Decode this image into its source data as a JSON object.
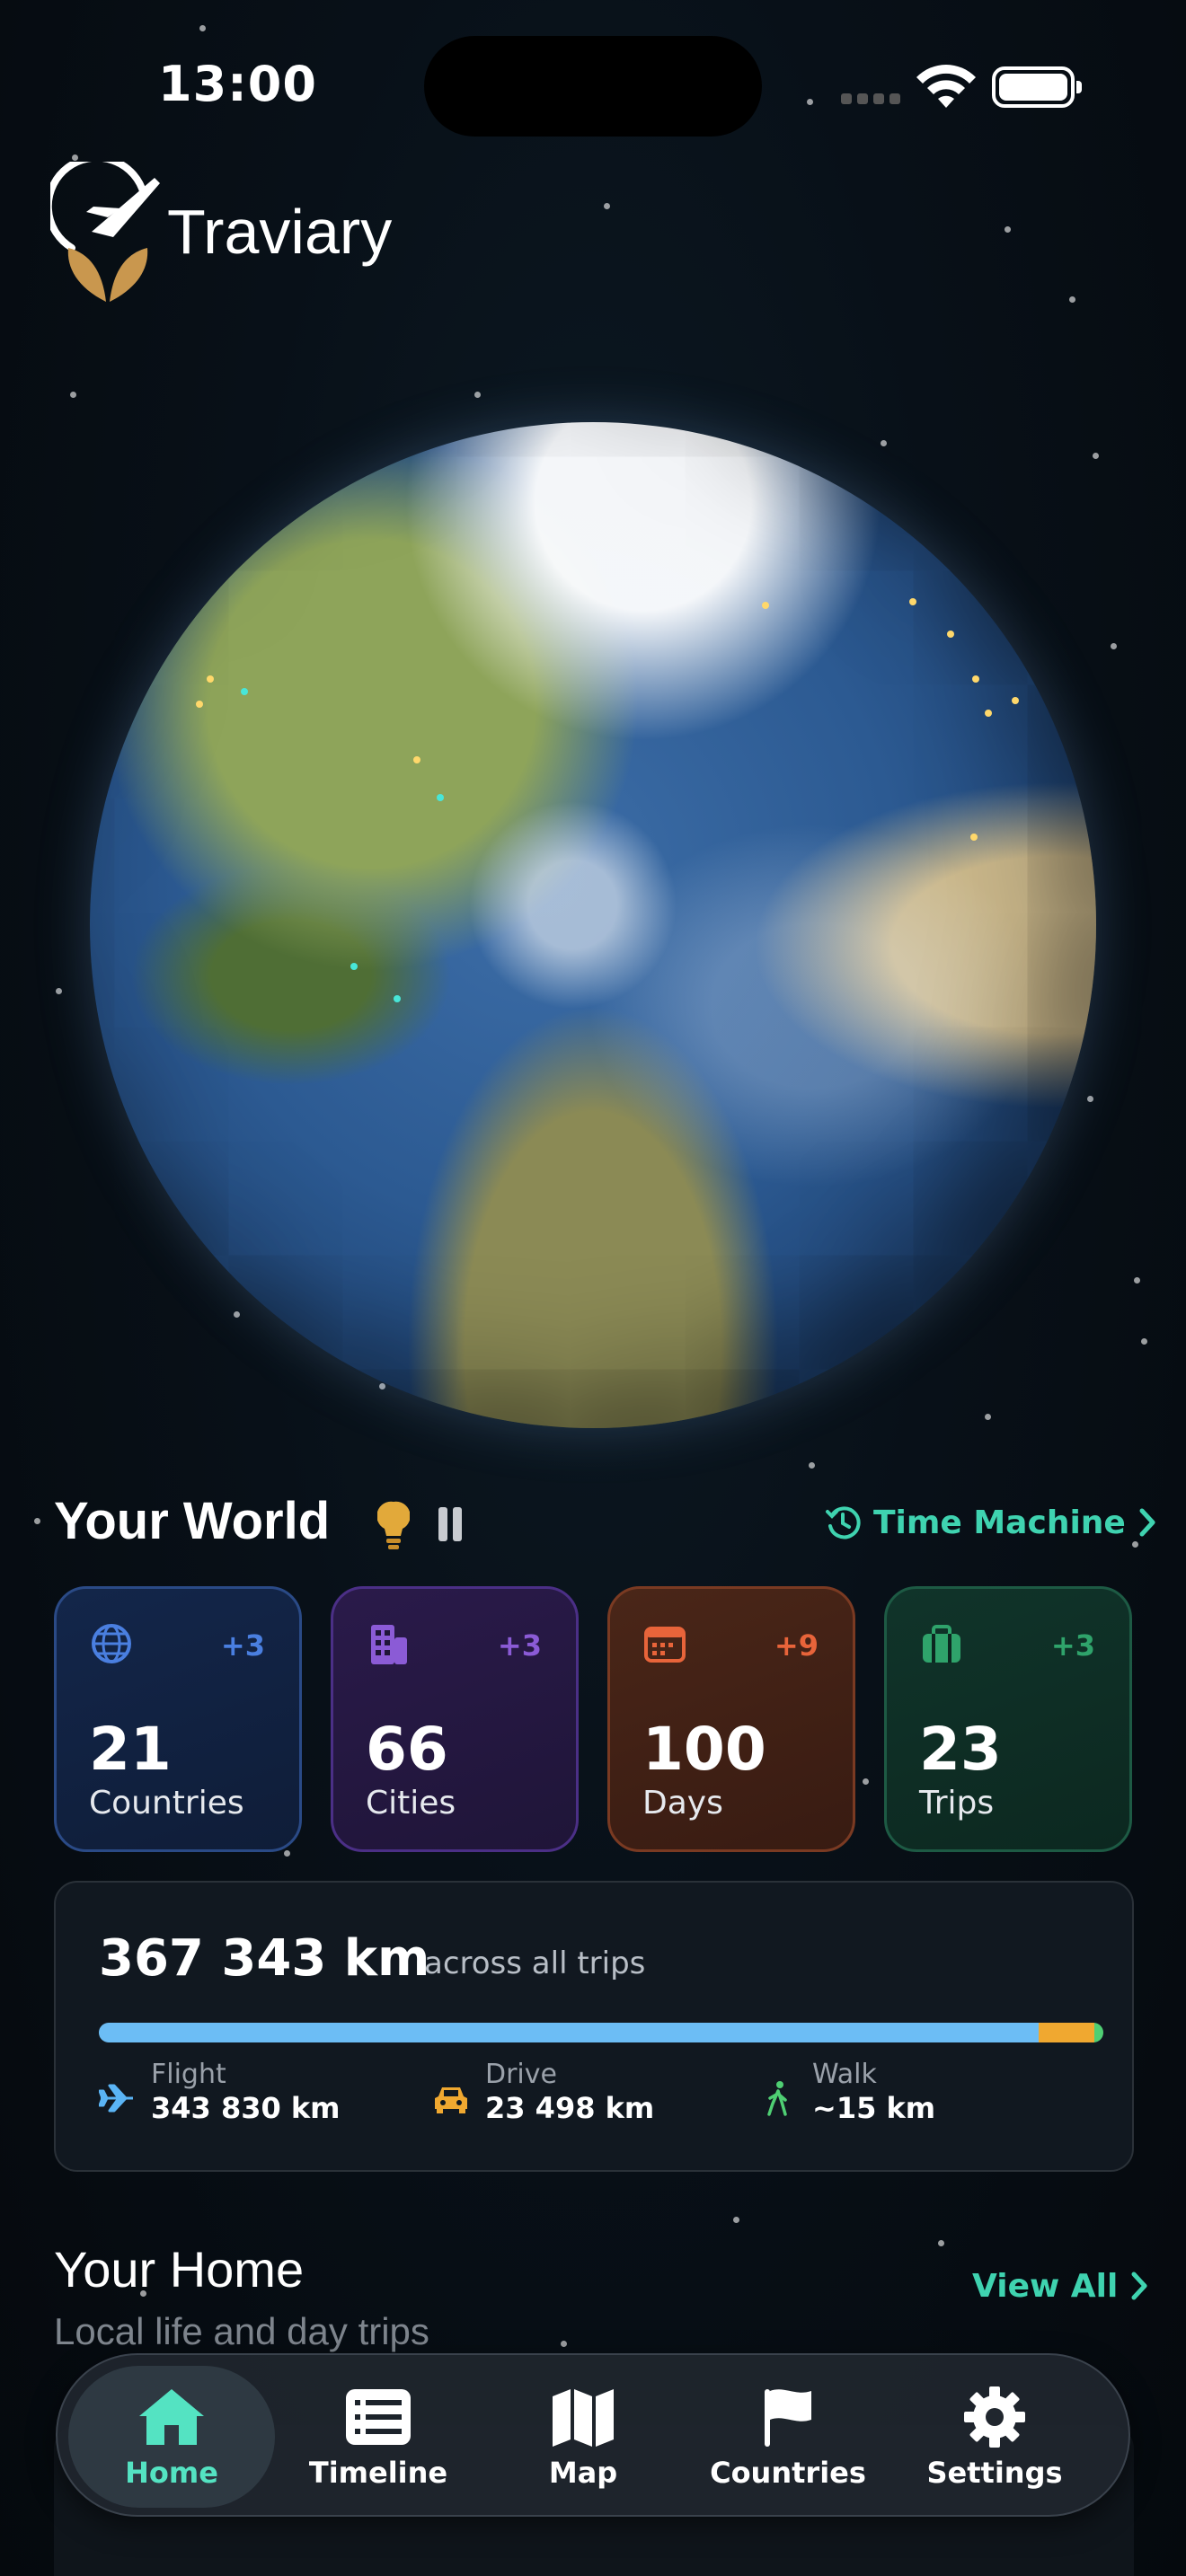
{
  "status_bar": {
    "time": "13:00"
  },
  "app": {
    "brand": "Traviary"
  },
  "colors": {
    "accent": "#3fd3b0",
    "globe_ocean": "#2c5a92"
  },
  "your_world": {
    "title": "Your World",
    "time_machine_label": "Time Machine",
    "stats": [
      {
        "icon": "globe-icon",
        "delta": "+3",
        "value": "21",
        "label": "Countries",
        "color": "#4a7fe0"
      },
      {
        "icon": "building-icon",
        "delta": "+3",
        "value": "66",
        "label": "Cities",
        "color": "#8b5bd6"
      },
      {
        "icon": "calendar-icon",
        "delta": "+9",
        "value": "100",
        "label": "Days",
        "color": "#e8643a"
      },
      {
        "icon": "briefcase-icon",
        "delta": "+3",
        "value": "23",
        "label": "Trips",
        "color": "#2fa36b"
      }
    ]
  },
  "distance": {
    "total": "367 343 km",
    "caption": "across all trips",
    "breakdown_fractions": {
      "flight": 0.936,
      "drive": 0.064,
      "walk": 0.0
    },
    "modes": [
      {
        "icon": "airplane-icon",
        "label": "Flight",
        "value": "343 830 km",
        "color": "#5ab4f5"
      },
      {
        "icon": "car-icon",
        "label": "Drive",
        "value": "23 498 km",
        "color": "#f0a830"
      },
      {
        "icon": "walk-icon",
        "label": "Walk",
        "value": "~15 km",
        "color": "#4fcf73"
      }
    ]
  },
  "your_home": {
    "title": "Your Home",
    "subtitle": "Local life and day trips",
    "view_all_label": "View All"
  },
  "tab_bar": {
    "tabs": [
      {
        "icon": "house-icon",
        "label": "Home",
        "active": true
      },
      {
        "icon": "list-icon",
        "label": "Timeline",
        "active": false
      },
      {
        "icon": "map-icon",
        "label": "Map",
        "active": false
      },
      {
        "icon": "flag-icon",
        "label": "Countries",
        "active": false
      },
      {
        "icon": "gear-icon",
        "label": "Settings",
        "active": false
      }
    ]
  }
}
